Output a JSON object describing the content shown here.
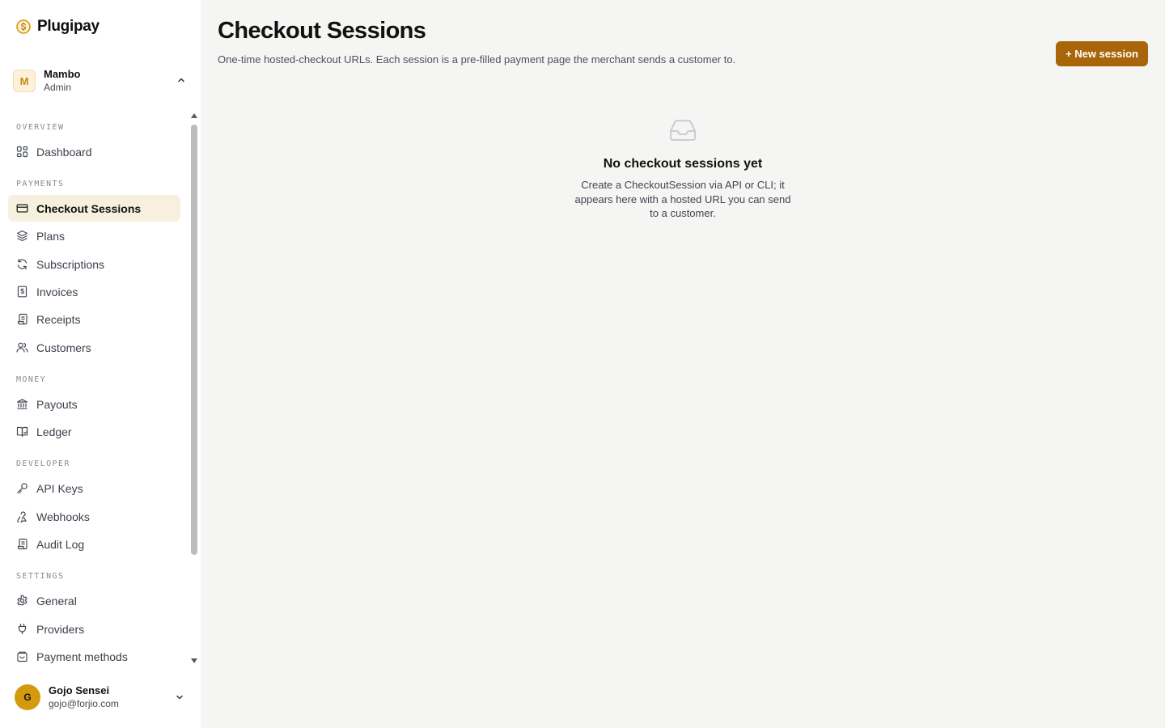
{
  "brand": {
    "name": "Plugipay",
    "accent": "#d49a0f"
  },
  "org": {
    "initial": "M",
    "name": "Mambo",
    "role": "Admin"
  },
  "nav": {
    "sections": [
      {
        "label": "OVERVIEW"
      },
      {
        "label": "PAYMENTS"
      },
      {
        "label": "MONEY"
      },
      {
        "label": "DEVELOPER"
      },
      {
        "label": "SETTINGS"
      }
    ],
    "items": [
      {
        "label": "Dashboard",
        "icon": "grid-icon"
      },
      {
        "label": "Checkout Sessions",
        "icon": "credit-card-icon",
        "active": true
      },
      {
        "label": "Plans",
        "icon": "layers-icon"
      },
      {
        "label": "Subscriptions",
        "icon": "refresh-icon"
      },
      {
        "label": "Invoices",
        "icon": "dollar-doc-icon"
      },
      {
        "label": "Receipts",
        "icon": "receipt-icon"
      },
      {
        "label": "Customers",
        "icon": "users-icon"
      },
      {
        "label": "Payouts",
        "icon": "bank-icon"
      },
      {
        "label": "Ledger",
        "icon": "book-icon"
      },
      {
        "label": "API Keys",
        "icon": "key-icon"
      },
      {
        "label": "Webhooks",
        "icon": "webhook-icon"
      },
      {
        "label": "Audit Log",
        "icon": "scroll-icon"
      },
      {
        "label": "General",
        "icon": "gear-icon"
      },
      {
        "label": "Providers",
        "icon": "plug-icon"
      },
      {
        "label": "Payment methods",
        "icon": "wallet-icon"
      }
    ]
  },
  "user": {
    "initial": "G",
    "name": "Gojo Sensei",
    "email": "gojo@forjio.com"
  },
  "header": {
    "title": "Checkout Sessions",
    "subtitle": "One-time hosted-checkout URLs. Each session is a pre-filled payment page the merchant sends a customer to.",
    "new_button": "+ New session",
    "button_color": "#a8650a"
  },
  "empty_state": {
    "icon": "inbox-icon",
    "title": "No checkout sessions yet",
    "description": "Create a CheckoutSession via API or CLI; it appears here with a hosted URL you can send to a customer."
  }
}
